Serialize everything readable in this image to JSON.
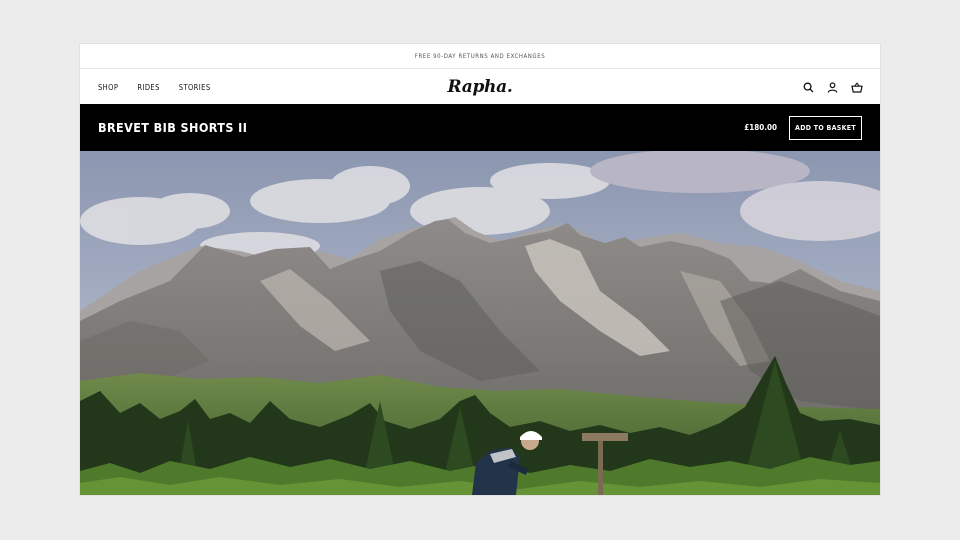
{
  "promo": {
    "text": "FREE 90-DAY RETURNS AND EXCHANGES"
  },
  "nav": {
    "links": [
      "SHOP",
      "RIDES",
      "STORIES"
    ],
    "logo": "Rapha.",
    "icons": [
      "search-icon",
      "account-icon",
      "basket-icon"
    ]
  },
  "product": {
    "title": "BREVET BIB SHORTS II",
    "price": "£180.00",
    "cta": "ADD TO BASKET"
  },
  "hero": {
    "scene": "mountain-landscape-with-cyclist"
  },
  "colors": {
    "bar": "#000000",
    "sky": "#9aa6bf",
    "rock": "#9a9690",
    "forest": "#2f4a22"
  }
}
